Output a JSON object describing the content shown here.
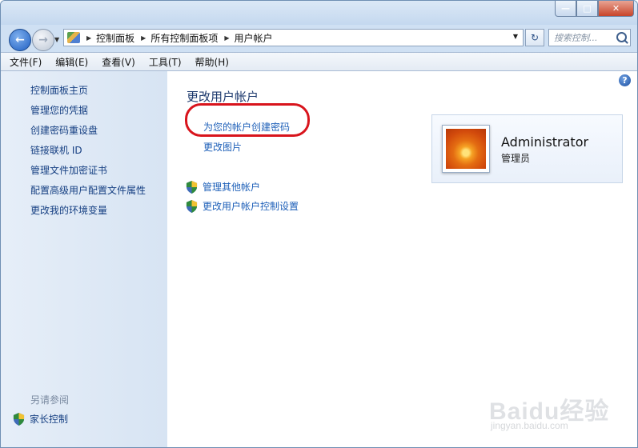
{
  "window": {
    "minimize": "—",
    "maximize": "□",
    "close": "✕"
  },
  "address_bar": {
    "breadcrumbs": [
      "控制面板",
      "所有控制面板项",
      "用户帐户"
    ],
    "refresh": "↻"
  },
  "search": {
    "placeholder": "搜索控制..."
  },
  "menu": [
    "文件(F)",
    "编辑(E)",
    "查看(V)",
    "工具(T)",
    "帮助(H)"
  ],
  "sidebar": {
    "links": [
      "控制面板主页",
      "管理您的凭据",
      "创建密码重设盘",
      "链接联机 ID",
      "管理文件加密证书",
      "配置高级用户配置文件属性",
      "更改我的环境变量"
    ],
    "see_also_heading": "另请参阅",
    "see_also": [
      "家长控制"
    ]
  },
  "main": {
    "help": "?",
    "title": "更改用户帐户",
    "links": [
      "为您的帐户创建密码",
      "更改图片"
    ],
    "admin_links": [
      "管理其他帐户",
      "更改用户帐户控制设置"
    ]
  },
  "user": {
    "name": "Administrator",
    "role": "管理员"
  },
  "watermark": {
    "logo": "Baidu经验",
    "url": "jingyan.baidu.com"
  },
  "colors": {
    "link": "#1d5fb8",
    "highlight_circle": "#d8141c",
    "title": "#1e3a6e"
  }
}
